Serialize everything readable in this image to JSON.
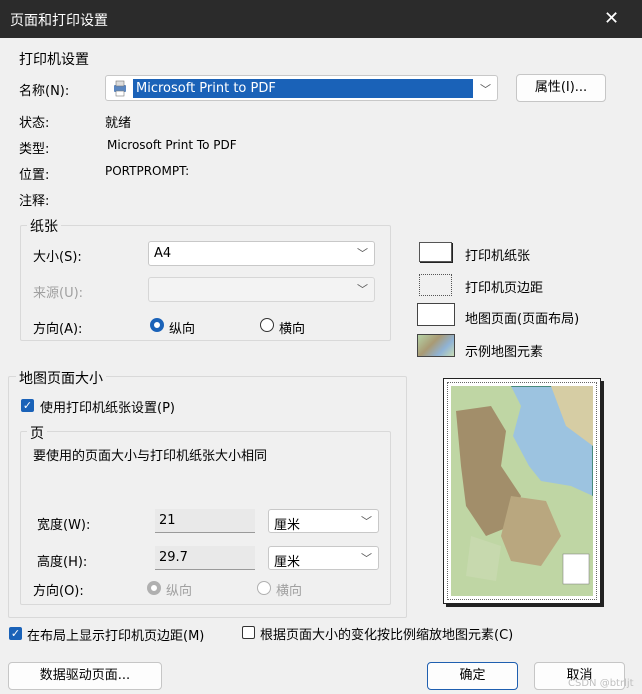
{
  "window": {
    "title": "页面和打印设置"
  },
  "printer": {
    "group_label": "打印机设置",
    "name_label": "名称(N):",
    "name_value": "Microsoft Print to PDF",
    "properties_button": "属性(I)...",
    "status_label": "状态:",
    "status_value": "就绪",
    "type_label": "类型:",
    "type_value": "Microsoft Print To PDF",
    "location_label": "位置:",
    "location_value": "PORTPROMPT:",
    "comment_label": "注释:"
  },
  "paper": {
    "group_label": "纸张",
    "size_label": "大小(S):",
    "size_value": "A4",
    "source_label": "来源(U):",
    "source_value": "",
    "orientation_label": "方向(A):",
    "portrait_label": "纵向",
    "landscape_label": "横向",
    "selected": "portrait"
  },
  "legend": {
    "printer_paper": "打印机纸张",
    "printer_margin": "打印机页边距",
    "map_page": "地图页面(页面布局)",
    "sample_elements": "示例地图元素"
  },
  "map_page_size": {
    "group_label": "地图页面大小",
    "use_printer_label": "使用打印机纸张设置(P)",
    "use_printer_checked": true,
    "page_group_label": "页",
    "description": "要使用的页面大小与打印机纸张大小相同",
    "width_label": "宽度(W):",
    "width_value": "21",
    "width_unit": "厘米",
    "height_label": "高度(H):",
    "height_value": "29.7",
    "height_unit": "厘米",
    "orientation_label": "方向(O):",
    "portrait_label": "纵向",
    "landscape_label": "横向"
  },
  "options": {
    "show_margins_label": "在布局上显示打印机页边距(M)",
    "show_margins_checked": true,
    "scale_elements_label": "根据页面大小的变化按比例缩放地图元素(C)",
    "scale_elements_checked": false
  },
  "buttons": {
    "data_driven": "数据驱动页面...",
    "ok": "确定",
    "cancel": "取消"
  },
  "watermark": "CSDN @btrljt",
  "colors": {
    "accent": "#1a62b8",
    "titlebar": "#2b2b2b",
    "selection": "#1a62b8"
  }
}
